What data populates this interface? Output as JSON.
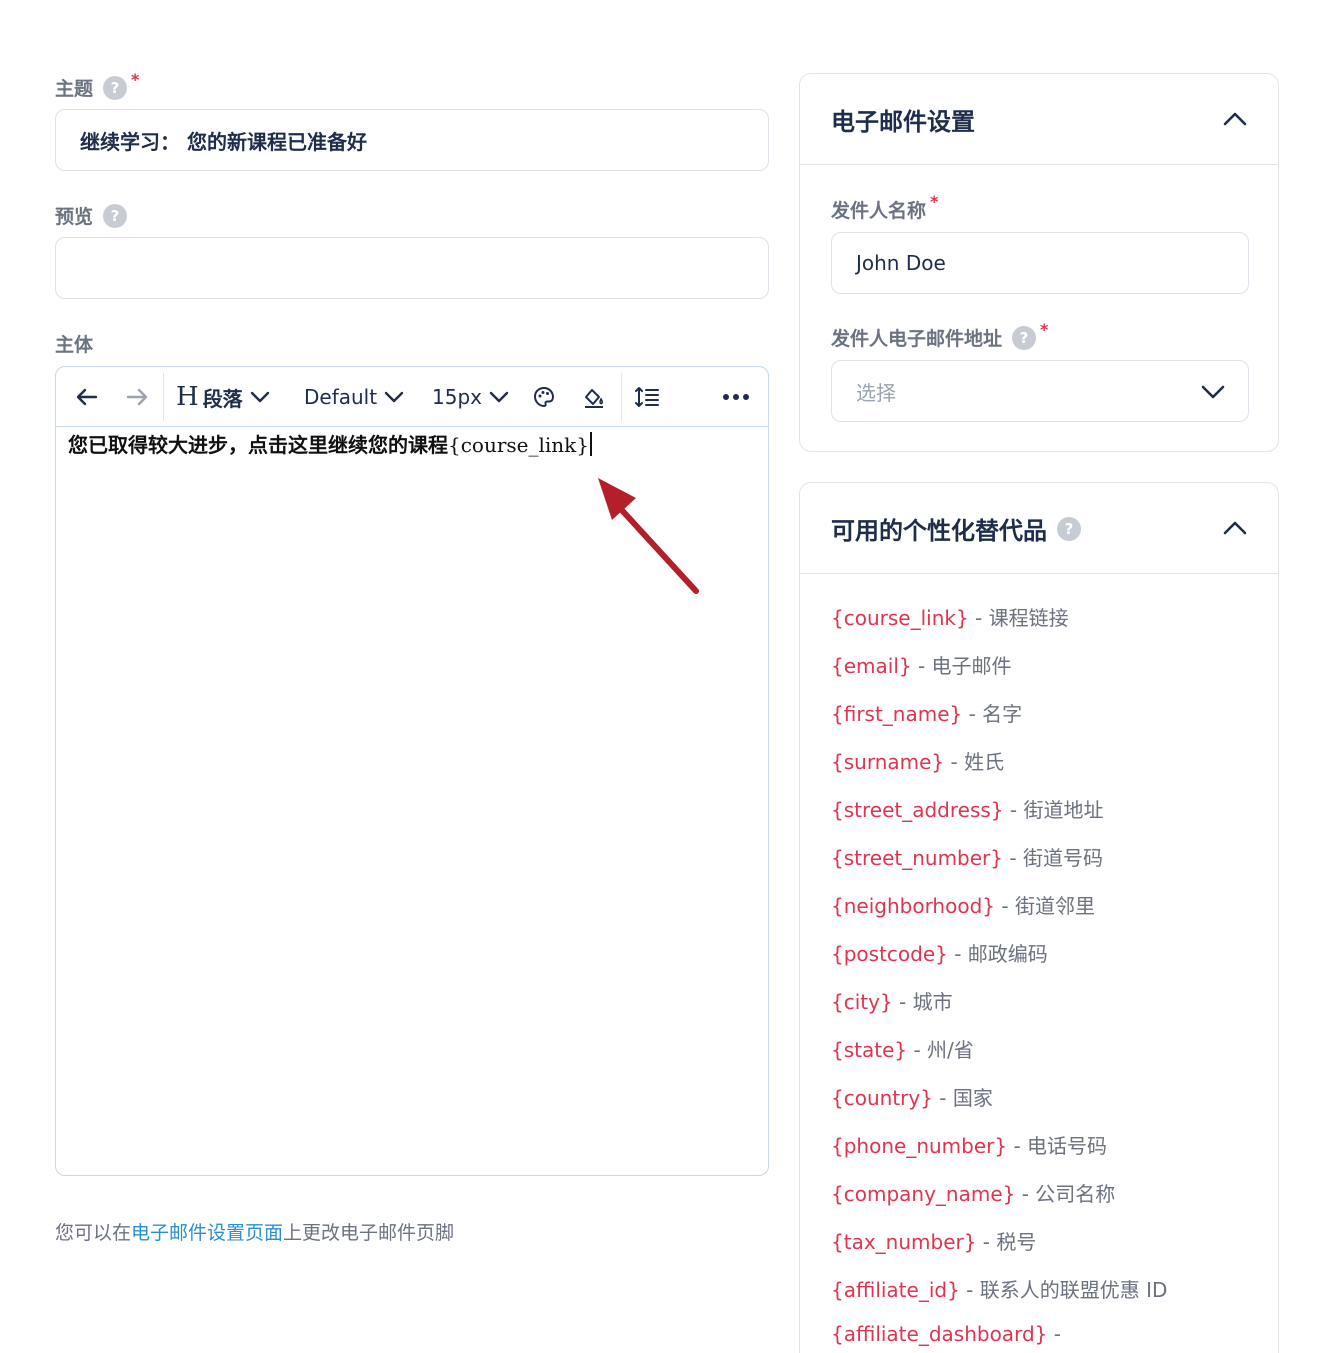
{
  "subject": {
    "label": "主题",
    "help": "?",
    "required": "*",
    "value": "继续学习： 您的新课程已准备好"
  },
  "preview": {
    "label": "预览",
    "help": "?",
    "value": ""
  },
  "body": {
    "label": "主体",
    "toolbar": {
      "heading_glyph": "H",
      "block_format": "段落",
      "font_family": "Default",
      "font_size": "15px",
      "icons": [
        "undo-icon",
        "redo-icon",
        "heading-icon",
        "chevron-down-icon",
        "text-color-icon",
        "highlight-color-icon",
        "line-height-icon",
        "more-icon"
      ]
    },
    "content_text": "您已取得较大进步，点击这里继续您的课程",
    "content_placeholder": "{course_link}"
  },
  "footer_note": {
    "prefix": "您可以在",
    "link": "电子邮件设置页面",
    "suffix": "上更改电子邮件页脚"
  },
  "email_settings": {
    "title": "电子邮件设置",
    "sender_name_label": "发件人名称",
    "sender_name_required": "*",
    "sender_name_value": "John Doe",
    "sender_email_label": "发件人电子邮件地址",
    "sender_email_help": "?",
    "sender_email_required": "*",
    "sender_email_placeholder": "选择"
  },
  "substitutes": {
    "title": "可用的个性化替代品",
    "help": "?",
    "items": [
      {
        "tag": "{course_link}",
        "desc": " - 课程链接"
      },
      {
        "tag": "{email}",
        "desc": " - 电子邮件"
      },
      {
        "tag": "{first_name}",
        "desc": " - 名字"
      },
      {
        "tag": "{surname}",
        "desc": " - 姓氏"
      },
      {
        "tag": "{street_address}",
        "desc": " - 街道地址"
      },
      {
        "tag": "{street_number}",
        "desc": " - 街道号码"
      },
      {
        "tag": "{neighborhood}",
        "desc": " - 街道邻里"
      },
      {
        "tag": "{postcode}",
        "desc": " - 邮政编码"
      },
      {
        "tag": "{city}",
        "desc": " - 城市"
      },
      {
        "tag": "{state}",
        "desc": " - 州/省"
      },
      {
        "tag": "{country}",
        "desc": " - 国家"
      },
      {
        "tag": "{phone_number}",
        "desc": " - 电话号码"
      },
      {
        "tag": "{company_name}",
        "desc": " - 公司名称"
      },
      {
        "tag": "{tax_number}",
        "desc": " - 税号"
      },
      {
        "tag": "{affiliate_id}",
        "desc": " - 联系人的联盟优惠 ID"
      },
      {
        "tag": "{affiliate_dashboard}",
        "desc": " -"
      }
    ]
  },
  "colors": {
    "accent_red": "#e0344f",
    "link_blue": "#2a8fd6",
    "arrow_red": "#b3202a",
    "title_navy": "#1f2d4a"
  }
}
